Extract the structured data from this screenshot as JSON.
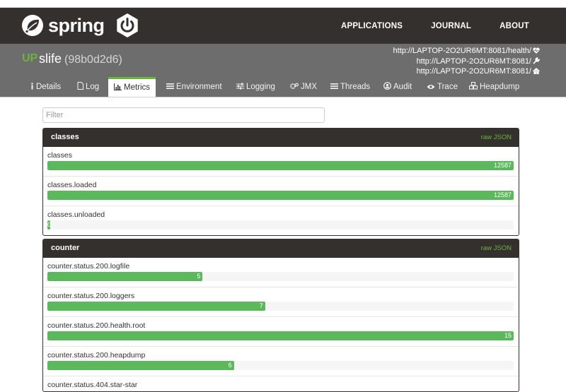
{
  "brand": {
    "name": "spring",
    "accent": "#6db33f",
    "dark": "#34302d"
  },
  "nav": [
    "APPLICATIONS",
    "JOURNAL",
    "ABOUT"
  ],
  "app": {
    "status": "UP",
    "name": "slife",
    "id": "(98b0d2d6)"
  },
  "urls": [
    {
      "text": "http://LAPTOP-2O2UR6MT:8081/health/",
      "icon": "heartbeat-icon"
    },
    {
      "text": "http://LAPTOP-2O2UR6MT:8081/",
      "icon": "wrench-icon"
    },
    {
      "text": "http://LAPTOP-2O2UR6MT:8081/",
      "icon": "home-icon"
    }
  ],
  "tabs": [
    {
      "label": "Details",
      "icon": "info-icon"
    },
    {
      "label": "Log",
      "icon": "file-icon"
    },
    {
      "label": "Metrics",
      "icon": "bar-chart-icon",
      "active": true
    },
    {
      "label": "Environment",
      "icon": "list-icon"
    },
    {
      "label": "Logging",
      "icon": "sliders-icon"
    },
    {
      "label": "JMX",
      "icon": "cogs-icon"
    },
    {
      "label": "Threads",
      "icon": "list-icon"
    },
    {
      "label": "Audit",
      "icon": "user-circle-icon"
    },
    {
      "label": "Trace",
      "icon": "eye-icon"
    },
    {
      "label": "Heapdump",
      "icon": "cubes-icon"
    }
  ],
  "filter": {
    "placeholder": "Filter",
    "value": ""
  },
  "panels": [
    {
      "title": "classes",
      "raw": "raw JSON",
      "metrics": [
        {
          "name": "classes",
          "value": "12587",
          "fraction": 1.0
        },
        {
          "name": "classes.loaded",
          "value": "12587",
          "fraction": 1.0
        },
        {
          "name": "classes.unloaded",
          "value": "0",
          "fraction": 0.0
        }
      ]
    },
    {
      "title": "counter",
      "raw": "raw JSON",
      "metrics": [
        {
          "name": "counter.status.200.logfile",
          "value": "5",
          "fraction": 0.333
        },
        {
          "name": "counter.status.200.loggers",
          "value": "7",
          "fraction": 0.467
        },
        {
          "name": "counter.status.200.health.root",
          "value": "15",
          "fraction": 1.0
        },
        {
          "name": "counter.status.200.heapdump",
          "value": "6",
          "fraction": 0.4
        },
        {
          "name": "counter.status.404.star-star",
          "value": "",
          "fraction": 0
        }
      ]
    }
  ]
}
